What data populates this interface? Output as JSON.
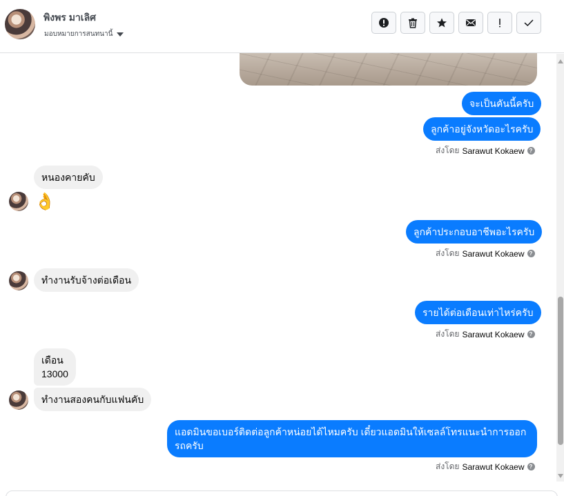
{
  "header": {
    "name": "พิงพร มาเลิศ",
    "assign_label": "มอบหมายการสนทนานี้",
    "actions": [
      {
        "icon": "alert-circle-icon",
        "label": ""
      },
      {
        "icon": "trash-icon",
        "label": ""
      },
      {
        "icon": "star-icon",
        "label": ""
      },
      {
        "icon": "envelope-icon",
        "label": ""
      },
      {
        "icon": "exclamation-icon",
        "label": ""
      },
      {
        "icon": "check-icon",
        "label": ""
      }
    ]
  },
  "messages": [
    {
      "side": "out",
      "text": "จะเป็นคันนี้ครับ"
    },
    {
      "side": "out",
      "text": "ลูกค้าอยู่จังหวัดอะไรครับ"
    },
    {
      "side": "in",
      "text": "หนองคายคับ"
    },
    {
      "side": "in",
      "text": "👌"
    },
    {
      "side": "out",
      "text": "ลูกค้าประกอบอาชีพอะไรครับ"
    },
    {
      "side": "in",
      "text": "ทำงานรับจ้างต่อเดือน"
    },
    {
      "side": "out",
      "text": "รายได้ต่อเดือนเท่าไหร่ครับ"
    },
    {
      "side": "in",
      "text": "เดือน\n13000"
    },
    {
      "side": "in",
      "text": "ทำงานสองคนกับแฟนคับ"
    },
    {
      "side": "out",
      "text": "แอดมินขอเบอร์ติดต่อลูกค้าหน่อยได้ไหมครับ เดี๋ยวแอดมินให้เซลล์โทรแนะนำการออกรถครับ"
    }
  ],
  "sent_by": {
    "prefix": "ส่งโดย",
    "name": "Sarawut Kokaew",
    "help_glyph": "?"
  },
  "colors": {
    "outgoing": "#0a7cff",
    "incoming": "#f0f0f0"
  }
}
